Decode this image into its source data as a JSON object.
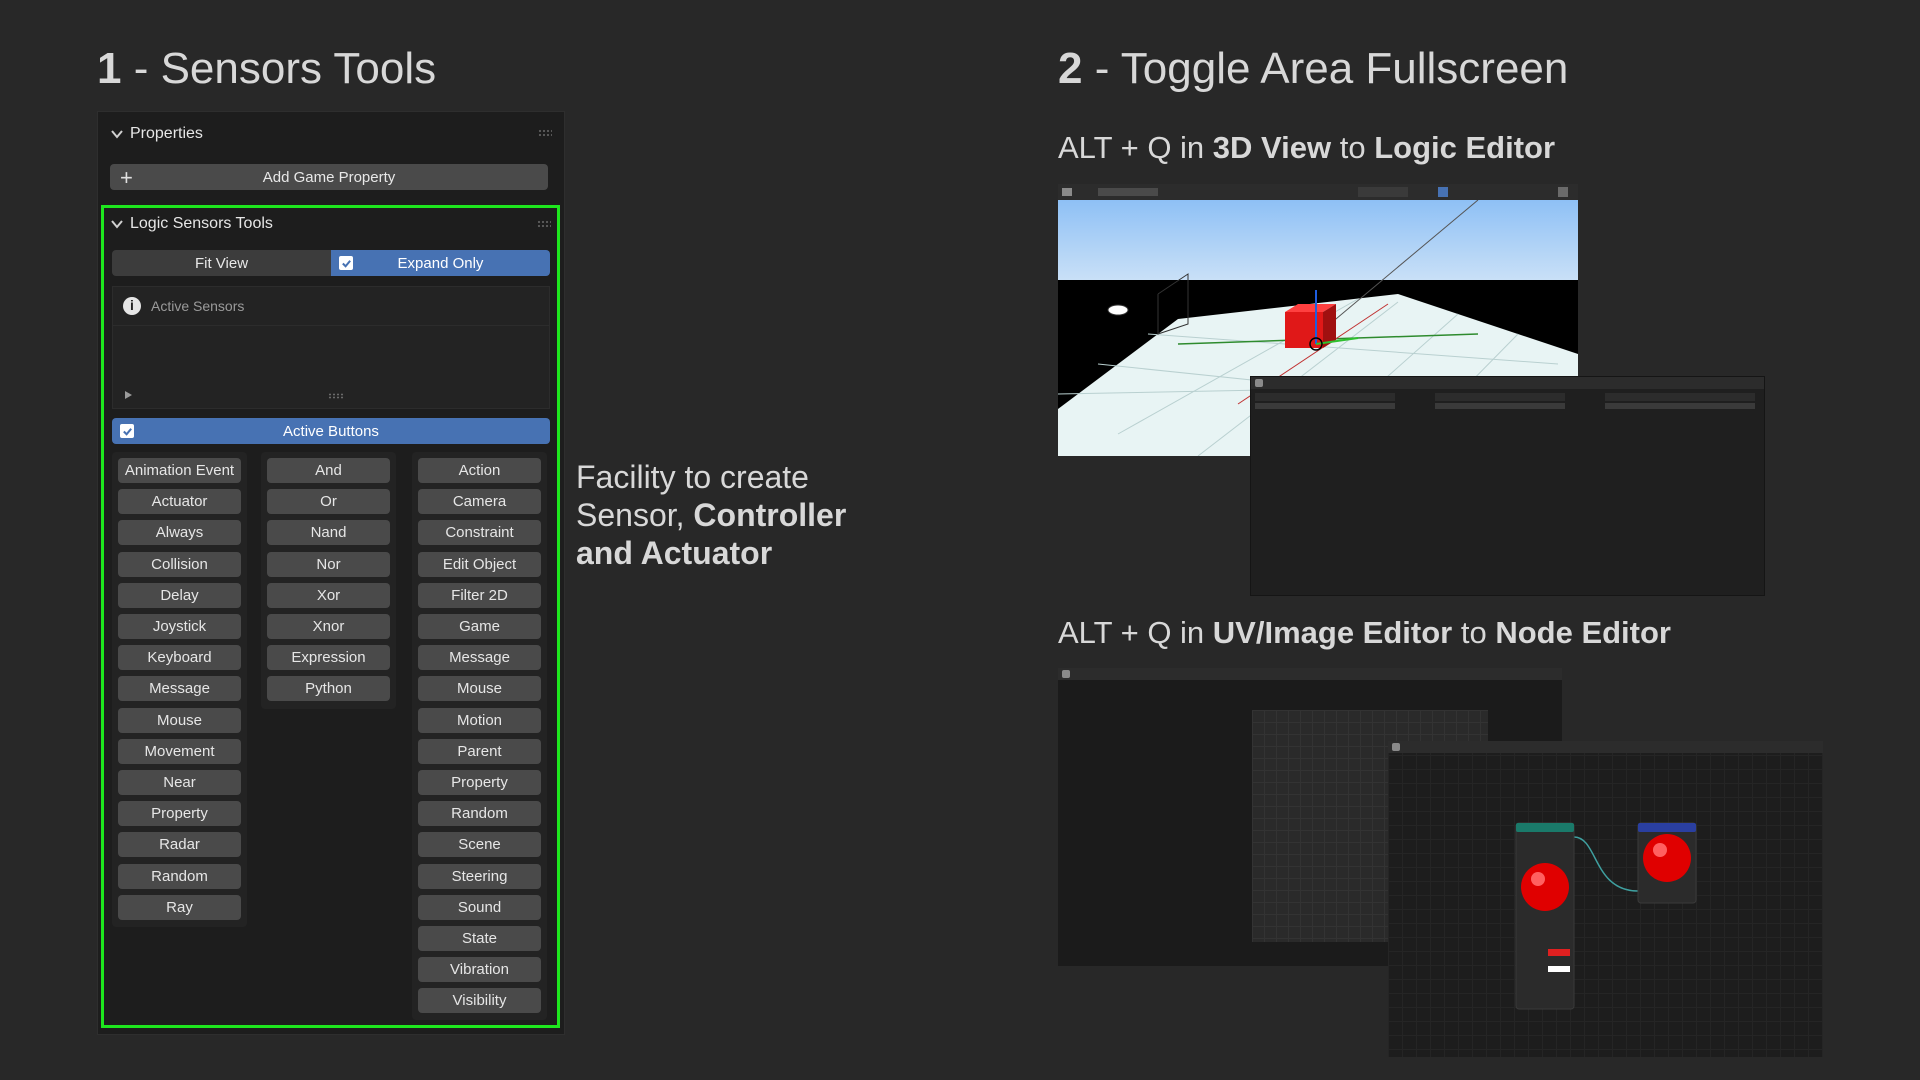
{
  "section1": {
    "num": "1",
    "title": " - Sensors Tools"
  },
  "section2": {
    "num": "2",
    "title": " - Toggle Area Fullscreen"
  },
  "sub1": {
    "pre": "ALT + Q in ",
    "bold1": "3D View",
    "mid": " to ",
    "bold2": "Logic Editor"
  },
  "sub2": {
    "pre": "ALT + Q in ",
    "bold1": "UV/Image Editor",
    "mid": " to ",
    "bold2": "Node Editor"
  },
  "description": {
    "line1": "Facility to create",
    "line2_pre": "Sensor, ",
    "line2_bold": "Controller",
    "line3_bold": "and Actuator"
  },
  "panel": {
    "properties_label": "Properties",
    "add_game_property": "Add Game Property",
    "logic_sensors_tools": "Logic Sensors Tools",
    "fit_view": "Fit View",
    "expand_only": "Expand Only",
    "expand_only_checked": true,
    "active_sensors": "Active Sensors",
    "active_buttons": "Active Buttons",
    "active_buttons_checked": true,
    "sensors": [
      "Animation Event",
      "Actuator",
      "Always",
      "Collision",
      "Delay",
      "Joystick",
      "Keyboard",
      "Message",
      "Mouse",
      "Movement",
      "Near",
      "Property",
      "Radar",
      "Random",
      "Ray"
    ],
    "controllers": [
      "And",
      "Or",
      "Nand",
      "Nor",
      "Xor",
      "Xnor",
      "Expression",
      "Python"
    ],
    "actuators": [
      "Action",
      "Camera",
      "Constraint",
      "Edit Object",
      "Filter 2D",
      "Game",
      "Message",
      "Mouse",
      "Motion",
      "Parent",
      "Property",
      "Random",
      "Scene",
      "Steering",
      "Sound",
      "State",
      "Vibration",
      "Visibility"
    ]
  },
  "colors": {
    "highlight_border": "#1ee61e",
    "accent_blue": "#4772b3",
    "background": "#282828"
  }
}
